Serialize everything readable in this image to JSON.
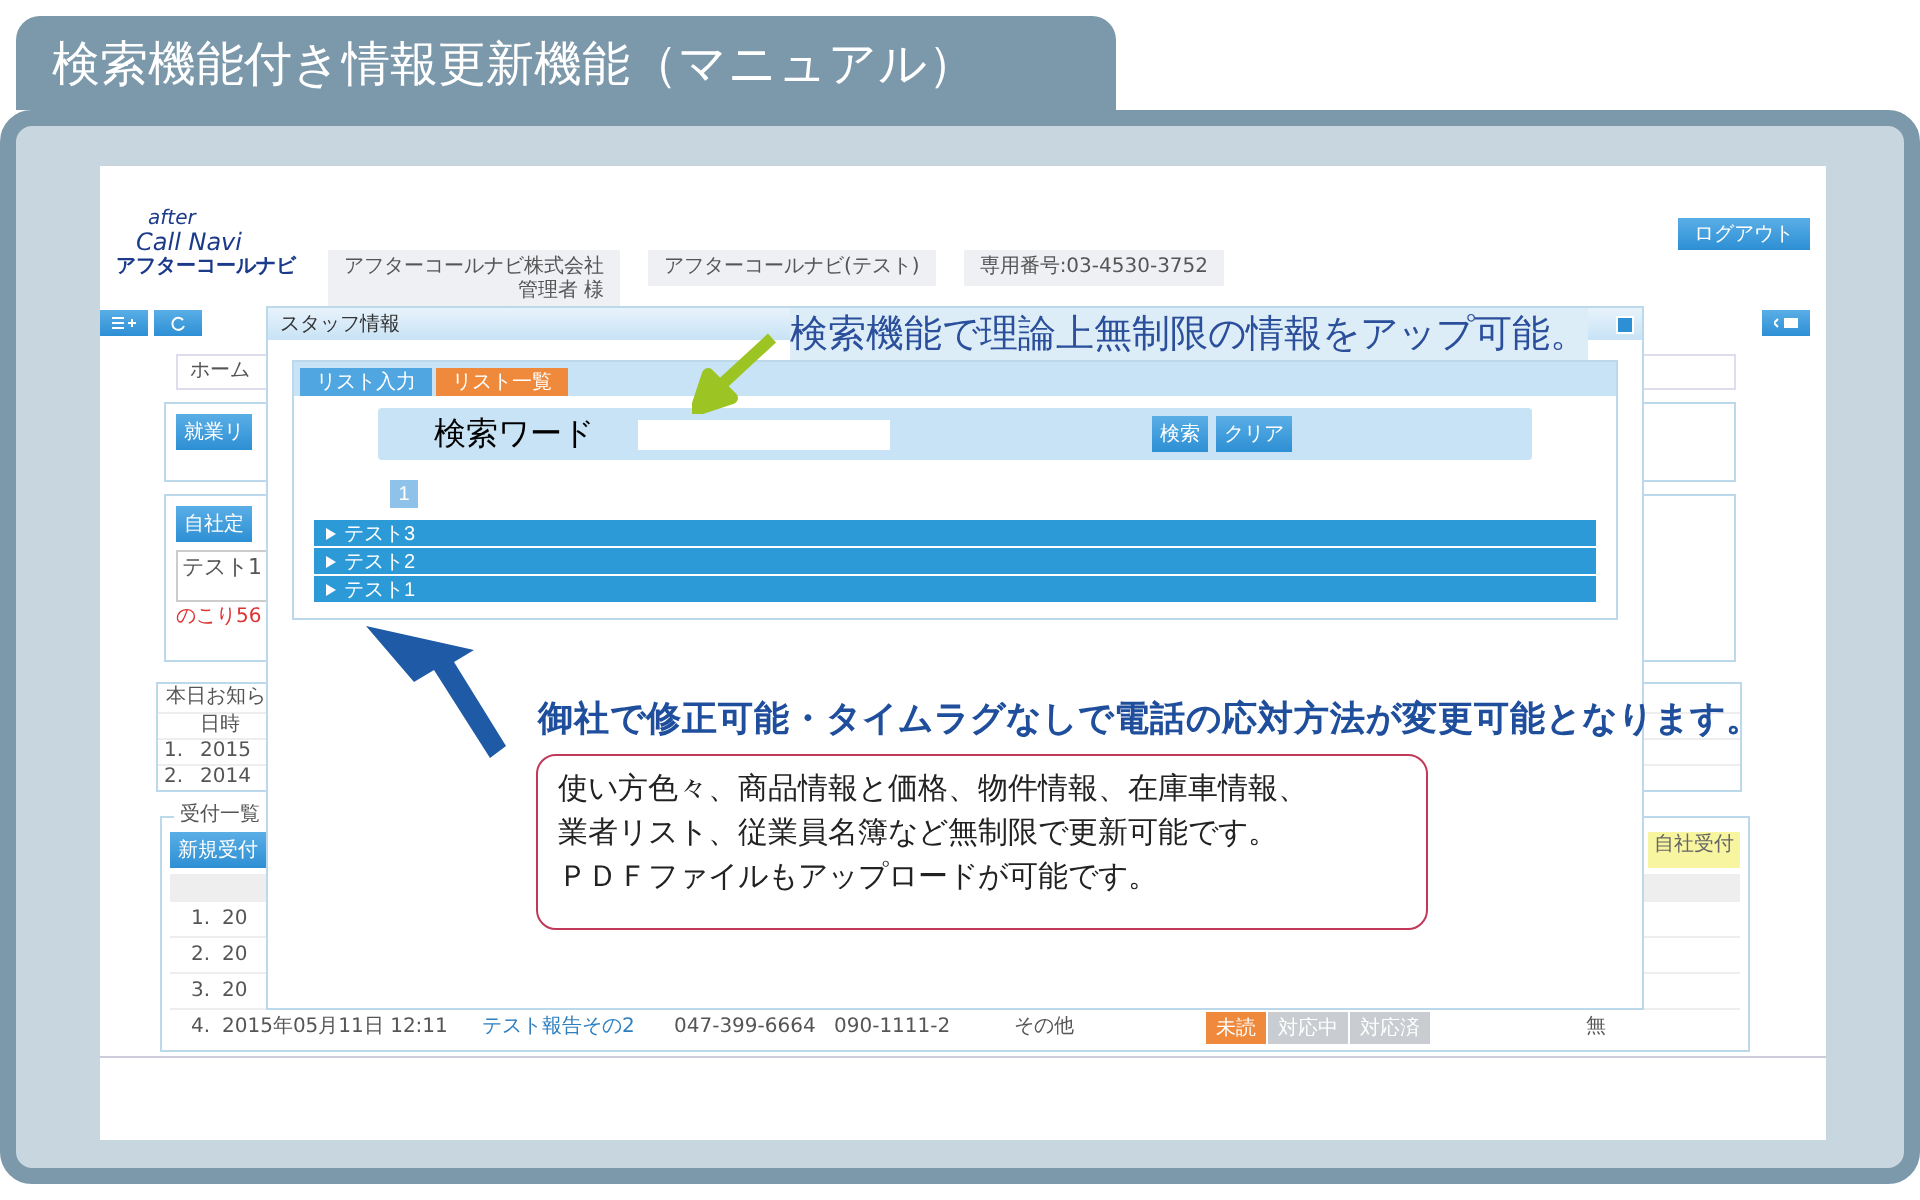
{
  "banner": {
    "title": "検索機能付き情報更新機能（マニュアル）"
  },
  "app": {
    "logo": {
      "line1": "after",
      "line2": "Call Navi",
      "line3": "アフターコールナビ"
    },
    "header_info": [
      {
        "lines": [
          "アフターコールナビ株式会社",
          "管理者 様"
        ]
      },
      {
        "lines": [
          "アフターコールナビ(テスト)"
        ]
      },
      {
        "lines": [
          "専用番号:03-4530-3752"
        ]
      }
    ],
    "logout_button": "ログアウト",
    "breadcrumb": "ホーム",
    "panel_button": "就業リ",
    "template": {
      "button": "自社定",
      "value": "テスト1",
      "remaining": "のこり56"
    },
    "notices": {
      "title": "本日お知ら",
      "column": "日時",
      "rows": [
        {
          "no": "1.",
          "date": "2015"
        },
        {
          "no": "2.",
          "date": "2014"
        }
      ]
    },
    "reception": {
      "legend": "受付一覧",
      "button": "新規受付",
      "right_label": "自社受付",
      "rows": [
        {
          "no": "1.",
          "date": "20"
        },
        {
          "no": "2.",
          "date": "20"
        },
        {
          "no": "3.",
          "date": "20"
        },
        {
          "no": "4.",
          "date": "2015年05月11日 12:11",
          "subject": "テスト報告その2",
          "phone": "047-399-6664",
          "mobile": "090-1111-2",
          "category": "その他",
          "statuses": [
            {
              "label": "未読",
              "selected": true
            },
            {
              "label": "対応中",
              "selected": false
            },
            {
              "label": "対応済",
              "selected": false
            }
          ],
          "flag": "無"
        }
      ]
    }
  },
  "dialog": {
    "title": "スタッフ情報",
    "tabs": [
      {
        "label": "リスト入力",
        "selected": false
      },
      {
        "label": "リスト一覧",
        "selected": true
      }
    ],
    "search": {
      "label": "検索ワード",
      "buttons": [
        "検索",
        "クリア"
      ]
    },
    "pages": [
      {
        "label": "1",
        "selected": true
      }
    ],
    "items": [
      {
        "label": "テスト3",
        "expanded": false
      },
      {
        "label": "テスト2",
        "expanded": false
      },
      {
        "label": "テスト1",
        "expanded": false
      }
    ]
  },
  "annotations": {
    "headline": "検索機能で理論上無制限の情報をアップ可能。",
    "note": "御社で修正可能・タイムラグなしで電話の応対方法が変更可能となります。",
    "callout": [
      "使い方色々、商品情報と価格、物件情報、在庫車情報、",
      "業者リスト、従業員名簿など無制限で更新可能です。",
      "ＰＤＦファイルもアップロードが可能です。"
    ]
  }
}
